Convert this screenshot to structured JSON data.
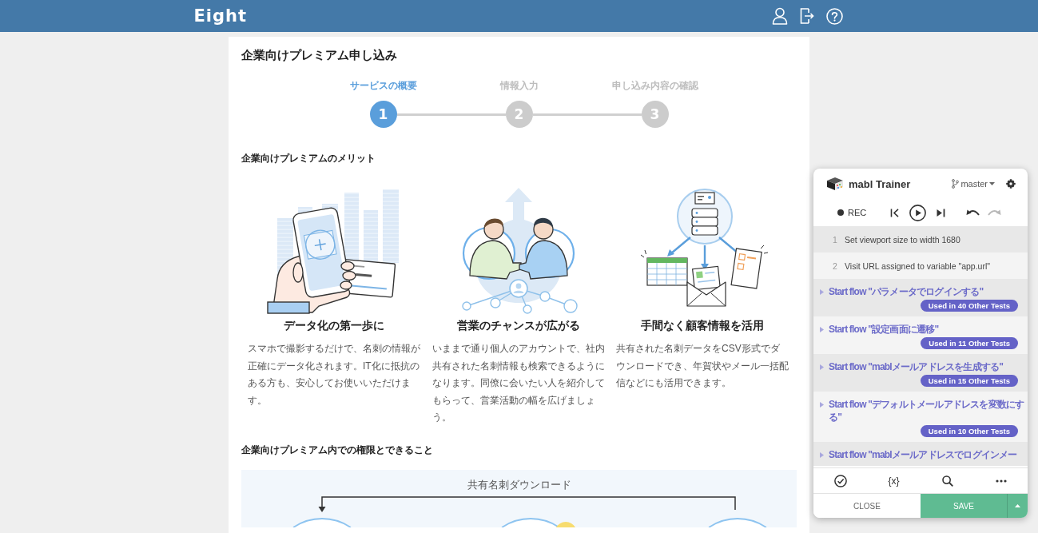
{
  "header": {
    "logo": "Eight"
  },
  "application": {
    "title": "企業向けプレミアム申し込み",
    "steps": [
      {
        "number": "1",
        "label": "サービスの概要",
        "selected": true
      },
      {
        "number": "2",
        "label": "情報入力",
        "selected": false
      },
      {
        "number": "3",
        "label": "申し込み内容の確認",
        "selected": false
      }
    ],
    "merits": {
      "heading": "企業向けプレミアムのメリット",
      "items": [
        {
          "kind": "scan",
          "title": "データ化の第一歩に",
          "body": "スマホで撮影するだけで、名刺の情報が正確にデータ化されます。IT化に抵抗のある方も、安心してお使いいただけます。"
        },
        {
          "kind": "network",
          "title": "営業のチャンスが広がる",
          "body": "いままで通り個人のアカウントで、社内共有された名刺情報も検索できるようになります。同僚に会いたい人を紹介してもらって、営業活動の幅を広げましょう。"
        },
        {
          "kind": "export",
          "title": "手間なく顧客情報を活用",
          "body": "共有された名刺データをCSV形式でダウンロードでき、年賀状やメール一括配信などにも活用できます。"
        }
      ]
    },
    "permissions": {
      "heading": "企業向けプレミアム内での権限とできること",
      "diagram_label": "共有名刺ダウンロード"
    }
  },
  "trainer": {
    "title": "mabl Trainer",
    "branch": "master",
    "record_label": "REC",
    "undo": {
      "disabled": false
    },
    "redo": {
      "disabled": true
    },
    "steps": [
      {
        "kind": "step",
        "number": "1",
        "text": "Set viewport size to width 1680"
      },
      {
        "kind": "step",
        "number": "2",
        "text": "Visit URL assigned to variable \"app.url\""
      },
      {
        "kind": "flow",
        "text": "Start flow \"パラメータでログインする\"",
        "badge": "Used in 40 Other Tests"
      },
      {
        "kind": "flow",
        "text": "Start flow \"設定画面に遷移\"",
        "badge": "Used in 11 Other Tests"
      },
      {
        "kind": "flow",
        "text": "Start flow \"mablメールアドレスを生成する\"",
        "badge": "Used in 15 Other Tests"
      },
      {
        "kind": "flow",
        "text": "Start flow \"デフォルトメールアドレスを変数にする\"",
        "badge": "Used in 10 Other Tests"
      },
      {
        "kind": "flow",
        "text": "Start flow \"mablメールアドレスでログインメー"
      }
    ],
    "variables_label": "{x}",
    "close_label": "CLOSE",
    "save_label": "SAVE"
  }
}
